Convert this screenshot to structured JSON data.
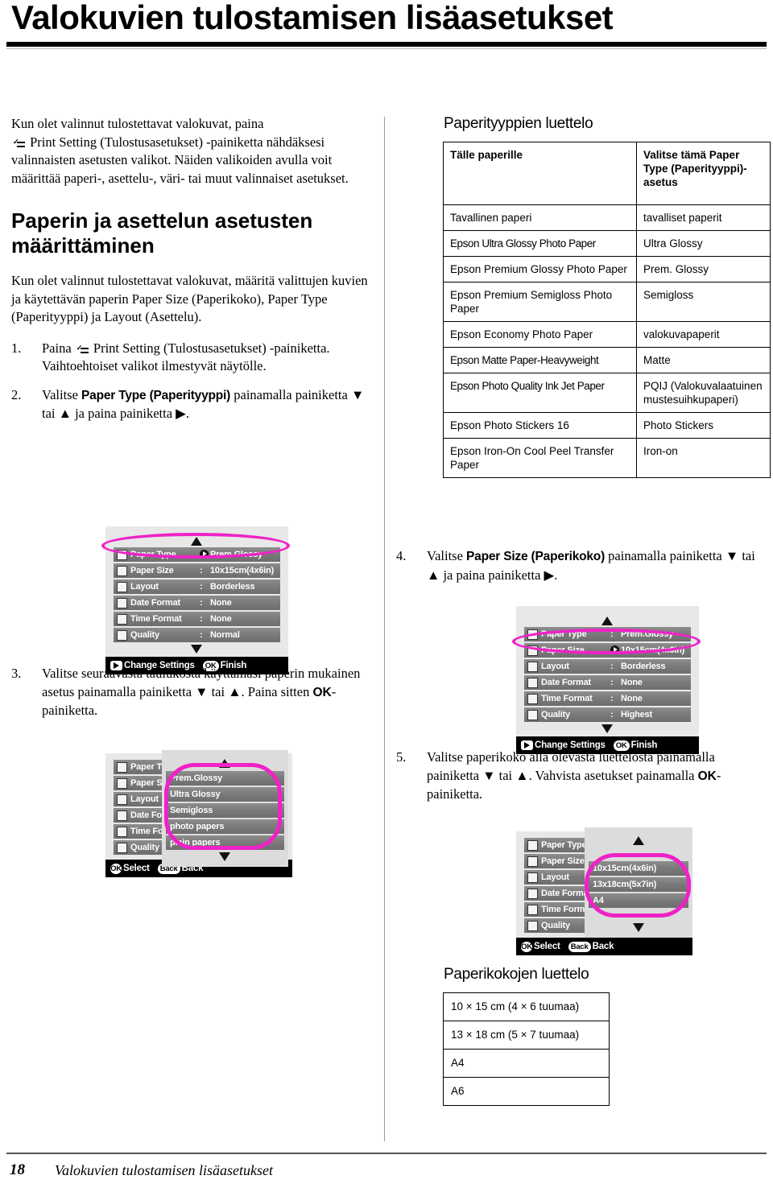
{
  "page": {
    "title": "Valokuvien tulostamisen lisäasetukset",
    "footer_number": "18",
    "footer_title": "Valokuvien tulostamisen lisäasetukset"
  },
  "left": {
    "intro": {
      "before_icon": "Kun olet valinnut tulostettavat valokuvat, paina",
      "after_icon": "Print Setting (Tulostusasetukset) -painiketta nähdäksesi valinnaisten asetusten valikot. Näiden valikoiden avulla voit määrittää paperi-, asettelu-, väri- tai muut valinnaiset asetukset."
    },
    "section_heading": "Paperin ja asettelun asetusten määrittäminen",
    "section_intro": "Kun olet valinnut tulostettavat valokuvat, määritä valittujen kuvien ja käytettävän paperin Paper Size (Paperikoko), Paper Type (Paperityyppi) ja Layout (Asettelu).",
    "steps": [
      {
        "num": "1.",
        "part1": "Paina",
        "part2": "Print Setting (Tulostusasetukset) -painiketta. Vaihtoehtoiset valikot ilmestyvät näytölle."
      },
      {
        "num": "2.",
        "part1": "Valitse",
        "bold": "Paper Type (Paperityyppi)",
        "part2": "painamalla painiketta ▼ tai ▲ ja paina painiketta ▶."
      },
      {
        "num": "3.",
        "part1": "Valitse seuraavasta taulukosta käyttämäsi paperin mukainen asetus painamalla painiketta ▼ tai ▲. Paina sitten",
        "bold": "OK",
        "part2": "-painiketta."
      }
    ]
  },
  "right": {
    "steps": [
      {
        "num": "4.",
        "part1": "Valitse",
        "bold": "Paper Size (Paperikoko)",
        "part2": "painamalla painiketta ▼ tai ▲ ja paina painiketta ▶."
      },
      {
        "num": "5.",
        "part1": "Valitse paperikoko alla olevasta luettelosta painamalla painiketta ▼ tai ▲. Vahvista asetukset painamalla",
        "bold": "OK",
        "part2": "-painiketta."
      }
    ],
    "paper_types_table": {
      "caption": "Paperityyppien luettelo",
      "headers": [
        "Tälle paperille",
        "Valitse tämä Paper Type (Paperityyppi)-asetus"
      ],
      "rows": [
        [
          "Tavallinen paperi",
          "tavalliset paperit"
        ],
        [
          "Epson Ultra Glossy Photo Paper",
          "Ultra Glossy"
        ],
        [
          "Epson Premium Glossy Photo Paper",
          "Prem. Glossy"
        ],
        [
          "Epson Premium Semigloss Photo Paper",
          "Semigloss"
        ],
        [
          "Epson Economy Photo Paper",
          "valokuvapaperit"
        ],
        [
          "Epson Matte Paper-Heavyweight",
          "Matte"
        ],
        [
          "Epson Photo Quality Ink Jet Paper",
          "PQIJ (Valokuvalaatuinen mustesuihkupaperi)"
        ],
        [
          "Epson Photo Stickers 16",
          "Photo Stickers"
        ],
        [
          "Epson Iron-On Cool Peel Transfer Paper",
          "Iron-on"
        ]
      ]
    },
    "paper_sizes_table": {
      "caption": "Paperikokojen luettelo",
      "rows": [
        "10 ×  15 cm (4 ×  6 tuumaa)",
        "13 ×  18 cm (5 ×  7 tuumaa)",
        "A4",
        "A6"
      ]
    }
  },
  "lcd": {
    "menu_labels": [
      "Paper Type",
      "Paper Size",
      "Layout",
      "Date Format",
      "Time Format",
      "Quality"
    ],
    "screen1": {
      "values": [
        "Prem.Glossy",
        "10x15cm(4x6in)",
        "Borderless",
        "None",
        "None",
        "Normal"
      ],
      "bar_action1": "Change Settings",
      "bar_key1": "▶",
      "bar_action2": "Finish",
      "bar_key2": "OK"
    },
    "screen2": {
      "values": [
        "Prem.Glossy",
        "10x15cm(4x6in)",
        "Borderless",
        "None",
        "None",
        "Highest"
      ],
      "bar_action1": "Change Settings",
      "bar_key1": "▶",
      "bar_action2": "Finish",
      "bar_key2": "OK"
    },
    "popup_paper_type": {
      "items": [
        "Prem.Glossy",
        "Ultra Glossy",
        "Semigloss",
        "photo papers",
        "plain papers"
      ],
      "bar_key1": "OK",
      "bar_action1": "Select",
      "bar_key2": "Back",
      "bar_action2": "Back"
    },
    "popup_paper_size": {
      "items": [
        "10x15cm(4x6in)",
        "13x18cm(5x7in)",
        "A4"
      ],
      "bar_key1": "OK",
      "bar_action1": "Select",
      "bar_key2": "Back",
      "bar_action2": "Back"
    }
  },
  "colors": {
    "highlight": "#ef22c8",
    "lcd_row": "#7b7b7b",
    "lcd_bg": "#e8e8e8"
  }
}
